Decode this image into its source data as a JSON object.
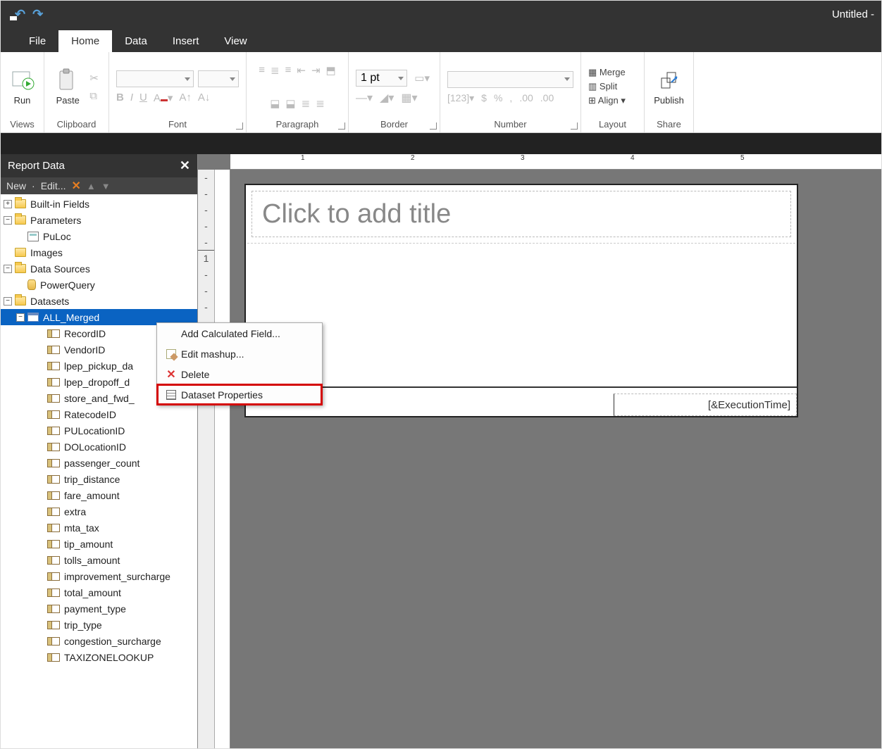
{
  "window": {
    "title": "Untitled -"
  },
  "tabs": {
    "file": "File",
    "home": "Home",
    "data": "Data",
    "insert": "Insert",
    "view": "View",
    "active": "home"
  },
  "ribbon": {
    "views": {
      "label": "Views",
      "run": "Run"
    },
    "clipboard": {
      "label": "Clipboard",
      "paste": "Paste"
    },
    "font": {
      "label": "Font"
    },
    "paragraph": {
      "label": "Paragraph"
    },
    "border": {
      "label": "Border",
      "width": "1 pt"
    },
    "number": {
      "label": "Number"
    },
    "layout": {
      "label": "Layout",
      "merge": "Merge",
      "split": "Split",
      "align": "Align"
    },
    "share": {
      "label": "Share",
      "publish": "Publish"
    }
  },
  "panel": {
    "title": "Report Data",
    "toolbar": {
      "new": "New",
      "edit": "Edit..."
    },
    "tree": {
      "builtin": "Built-in Fields",
      "parameters": "Parameters",
      "param_items": [
        "PuLoc"
      ],
      "images": "Images",
      "datasources": "Data Sources",
      "ds_items": [
        "PowerQuery"
      ],
      "datasets": "Datasets",
      "dataset_name": "ALL_Merged",
      "fields": [
        "RecordID",
        "VendorID",
        "lpep_pickup_da",
        "lpep_dropoff_d",
        "store_and_fwd_",
        "RatecodeID",
        "PULocationID",
        "DOLocationID",
        "passenger_count",
        "trip_distance",
        "fare_amount",
        "extra",
        "mta_tax",
        "tip_amount",
        "tolls_amount",
        "improvement_surcharge",
        "total_amount",
        "payment_type",
        "trip_type",
        "congestion_surcharge",
        "TAXIZONELOOKUP"
      ]
    }
  },
  "context_menu": {
    "items": [
      {
        "key": "add_calc",
        "label": "Add Calculated Field..."
      },
      {
        "key": "edit_mashup",
        "label": "Edit mashup..."
      },
      {
        "key": "delete",
        "label": "Delete"
      },
      {
        "key": "props",
        "label": "Dataset Properties",
        "highlighted": true
      }
    ]
  },
  "canvas": {
    "title_placeholder": "Click to add title",
    "footer_expr": "[&ExecutionTime]"
  }
}
